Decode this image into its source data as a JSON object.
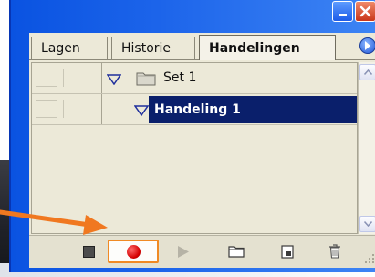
{
  "panel": {
    "tabs": [
      {
        "label": "Lagen"
      },
      {
        "label": "Historie"
      },
      {
        "label": "Handelingen",
        "active": true
      }
    ]
  },
  "actions": [
    {
      "label": "Set 1",
      "type": "set",
      "expanded": true,
      "selected": false
    },
    {
      "label": "Handeling 1",
      "type": "action",
      "expanded": true,
      "selected": true
    }
  ],
  "toolbar": {
    "buttons": [
      {
        "icon": "stop-icon"
      },
      {
        "icon": "record-icon",
        "highlighted": true
      },
      {
        "icon": "play-icon"
      },
      {
        "icon": "new-set-folder-icon"
      },
      {
        "icon": "new-action-icon"
      },
      {
        "icon": "trash-icon"
      }
    ]
  },
  "colors": {
    "titlebar": "#1c64ea",
    "selection": "#0a1f6b",
    "record": "#d40000",
    "annotation_arrow": "#f07820"
  }
}
